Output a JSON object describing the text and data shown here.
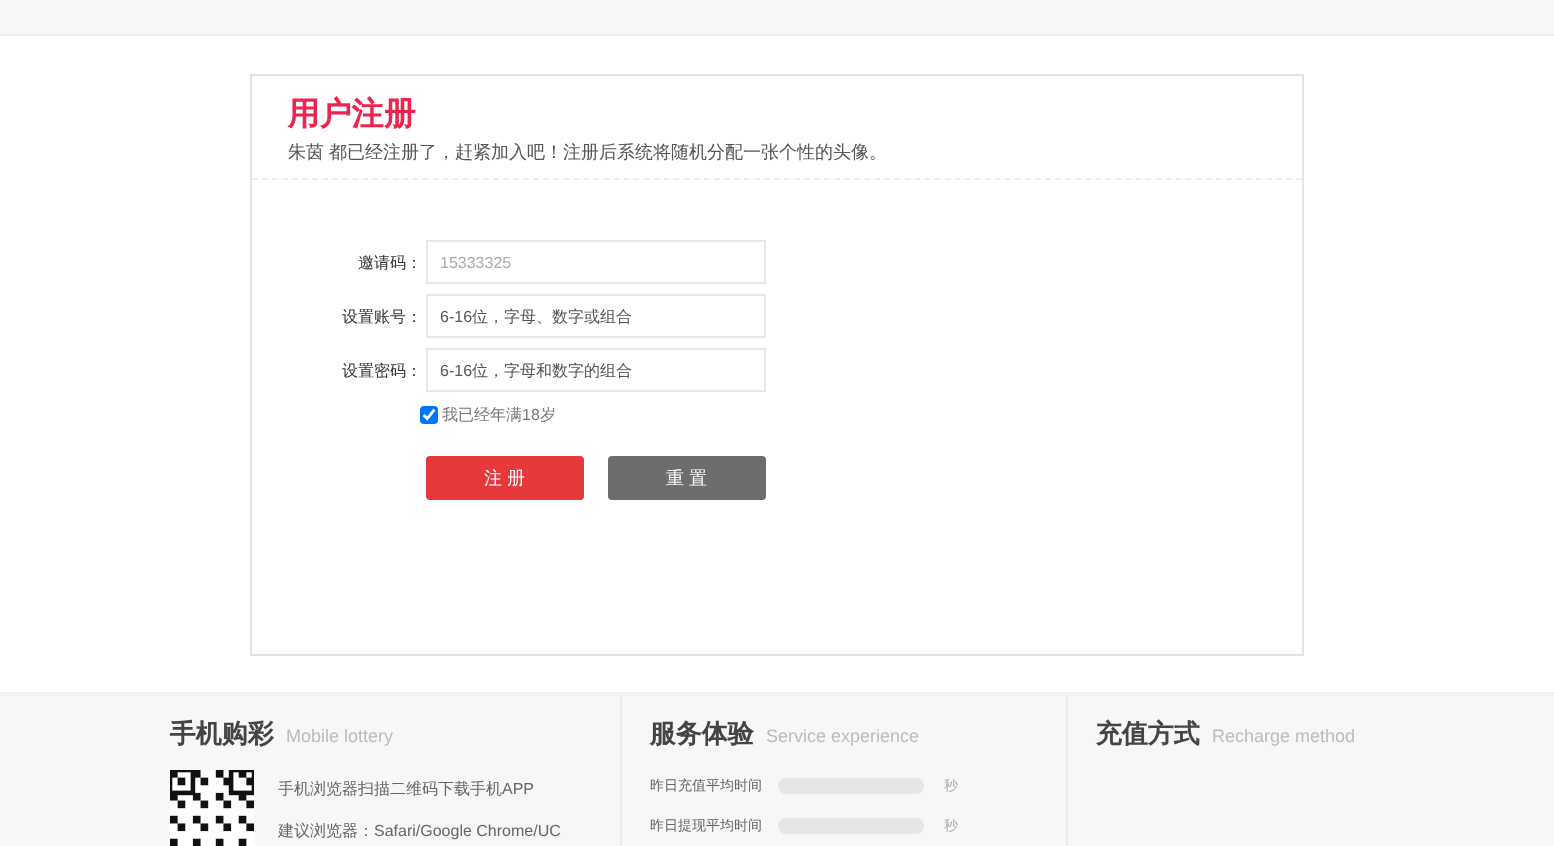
{
  "register": {
    "title": "用户注册",
    "subtitle": "朱茵 都已经注册了，赶紧加入吧！注册后系统将随机分配一张个性的头像。",
    "fields": [
      {
        "label": "邀请码：",
        "value": "15333325"
      },
      {
        "label": "设置账号：",
        "placeholder": "6-16位，字母、数字或组合"
      },
      {
        "label": "设置密码：",
        "placeholder": "6-16位，字母和数字的组合"
      }
    ],
    "agree": {
      "label": "我已经年满18岁",
      "checked": true
    },
    "buttons": [
      {
        "label": "注 册",
        "kind": "primary"
      },
      {
        "label": "重 置",
        "kind": "secondary"
      }
    ]
  },
  "footer": {
    "mobile": {
      "title": "手机购彩",
      "subtitle": "Mobile lottery",
      "lines": [
        "手机浏览器扫描二维码下载手机APP",
        "建议浏览器：Safari/Google Chrome/UC"
      ]
    },
    "service": {
      "title": "服务体验",
      "subtitle": "Service experience",
      "meters": [
        {
          "label": "昨日充值平均时间",
          "unit": "秒"
        },
        {
          "label": "昨日提现平均时间",
          "unit": "秒"
        }
      ]
    },
    "recharge": {
      "title": "充值方式",
      "subtitle": "Recharge method"
    }
  }
}
